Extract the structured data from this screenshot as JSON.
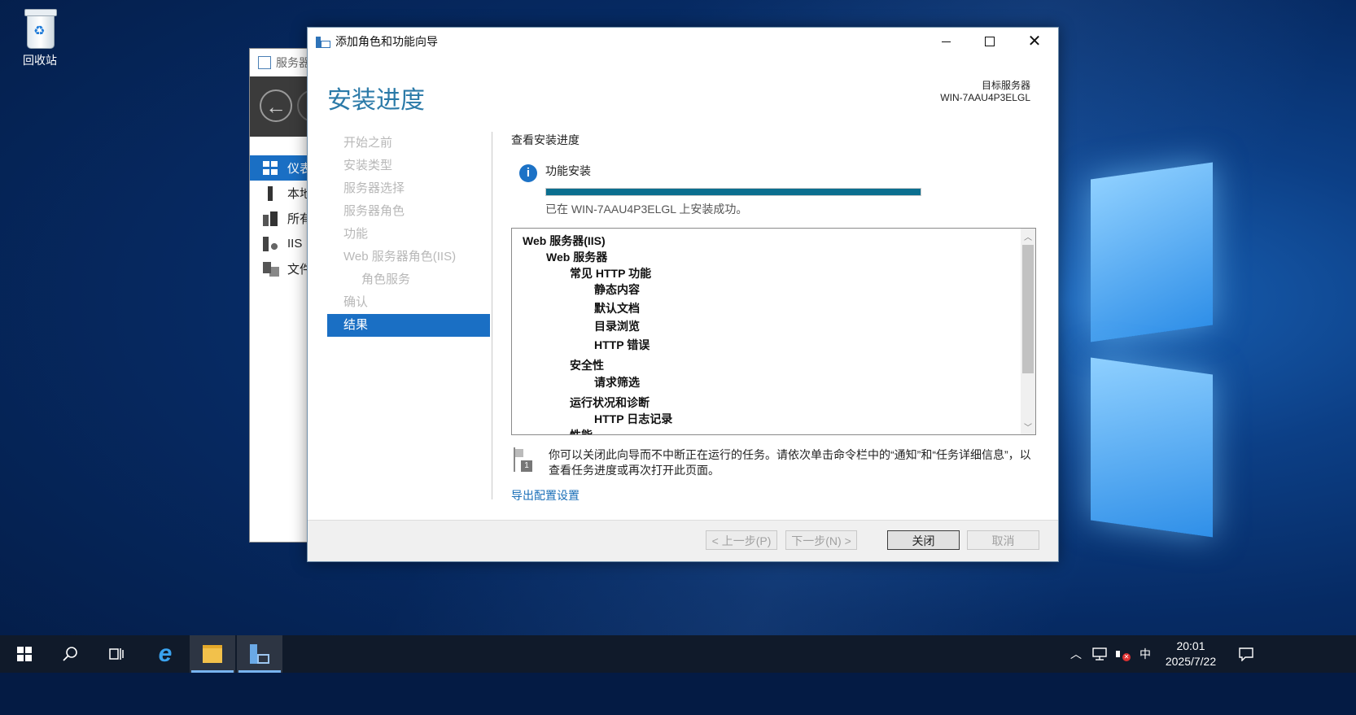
{
  "desktop": {
    "recycle_bin_label": "回收站"
  },
  "server_manager": {
    "title": "服务器",
    "nav_items": [
      "仪表",
      "本地",
      "所有",
      "IIS",
      "文件"
    ]
  },
  "wizard": {
    "window_title": "添加角色和功能向导",
    "page_title": "安装进度",
    "target_label": "目标服务器",
    "target_server": "WIN-7AAU4P3ELGL",
    "steps": [
      {
        "label": "开始之前",
        "state": "disabled"
      },
      {
        "label": "安装类型",
        "state": "disabled"
      },
      {
        "label": "服务器选择",
        "state": "disabled"
      },
      {
        "label": "服务器角色",
        "state": "disabled"
      },
      {
        "label": "功能",
        "state": "disabled"
      },
      {
        "label": "Web 服务器角色(IIS)",
        "state": "disabled"
      },
      {
        "label": "角色服务",
        "state": "disabled"
      },
      {
        "label": "确认",
        "state": "disabled"
      },
      {
        "label": "结果",
        "state": "selected"
      }
    ],
    "section_label": "查看安装进度",
    "feature_install_label": "功能安装",
    "progress": 1.0,
    "progress_color": "#0b6f8f",
    "success_message": "已在 WIN-7AAU4P3ELGL 上安装成功。",
    "installed_items": [
      {
        "text": "Web 服务器(IIS)",
        "level": 0
      },
      {
        "text": "Web 服务器",
        "level": 1
      },
      {
        "text": "常见 HTTP 功能",
        "level": 2
      },
      {
        "text": "静态内容",
        "level": 3
      },
      {
        "text": "默认文档",
        "level": 3
      },
      {
        "text": "目录浏览",
        "level": 3
      },
      {
        "text": "HTTP 错误",
        "level": 3
      },
      {
        "text": "安全性",
        "level": 2
      },
      {
        "text": "请求筛选",
        "level": 3
      },
      {
        "text": "运行状况和诊断",
        "level": 2
      },
      {
        "text": "HTTP 日志记录",
        "level": 3
      },
      {
        "text": "性能",
        "level": 2
      }
    ],
    "note": "你可以关闭此向导而不中断正在运行的任务。请依次单击命令栏中的“通知”和“任务详细信息”，以查看任务进度或再次打开此页面。",
    "export_link": "导出配置设置",
    "buttons": {
      "prev": "< 上一步(P)",
      "next": "下一步(N) >",
      "close": "关闭",
      "cancel": "取消"
    },
    "accent_color": "#1a6fc4"
  },
  "taskbar": {
    "ime": "中",
    "time": "20:01",
    "date": "2025/7/22"
  }
}
